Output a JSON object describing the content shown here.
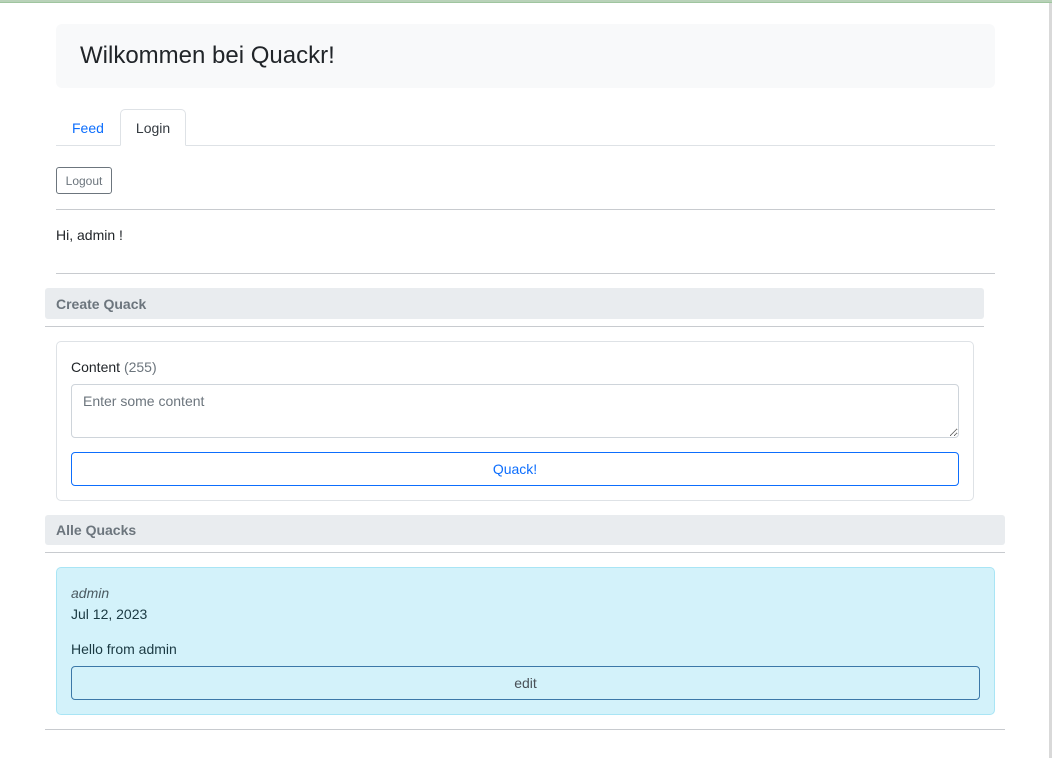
{
  "header": {
    "title": "Wilkommen bei Quackr!"
  },
  "tabs": [
    {
      "label": "Feed",
      "active": false
    },
    {
      "label": "Login",
      "active": true
    }
  ],
  "auth": {
    "logout_label": "Logout",
    "greeting": "Hi, admin !"
  },
  "create": {
    "section_title": "Create Quack",
    "content_label": "Content",
    "content_count": "(255)",
    "placeholder": "Enter some content",
    "value": "",
    "submit_label": "Quack!"
  },
  "feed": {
    "section_title": "Alle Quacks",
    "quacks": [
      {
        "author": "admin",
        "date": "Jul 12, 2023",
        "text": "Hello from admin",
        "edit_label": "edit"
      }
    ]
  },
  "colors": {
    "link": "#0d6efd",
    "quack_bg": "#d3f2fa",
    "section_bg": "#e9ecef",
    "jumbotron_bg": "#f8f9fa"
  }
}
